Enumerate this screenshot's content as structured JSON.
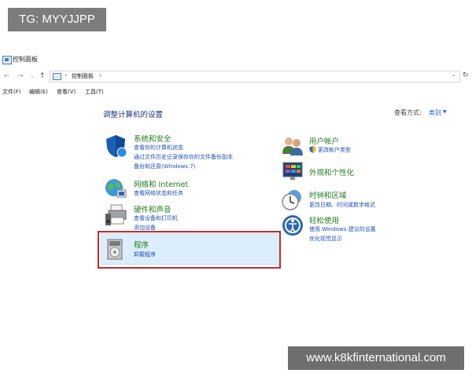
{
  "watermark_top": "TG: MYYJJPP",
  "window": {
    "title": "控制面板"
  },
  "address": {
    "crumb": "控制面板"
  },
  "menu": [
    "文件(F)",
    "编辑(E)",
    "查看(V)",
    "工具(T)"
  ],
  "page": {
    "title": "调整计算机的设置",
    "view_by_label": "查看方式:",
    "view_by_value": "类别"
  },
  "categories_left": [
    {
      "title": "系统和安全",
      "links": [
        "查看你的计算机状态",
        "通过文件历史记录保存你的文件备份副本",
        "备份和还原(Windows 7)"
      ]
    },
    {
      "title": "网络和 Internet",
      "links": [
        "查看网络状态和任务"
      ]
    },
    {
      "title": "硬件和声音",
      "links": [
        "查看设备和打印机",
        "添加设备"
      ]
    },
    {
      "title": "程序",
      "links": [
        "卸载程序"
      ]
    }
  ],
  "categories_right": [
    {
      "title": "用户帐户",
      "links": [
        "更改帐户类型"
      ]
    },
    {
      "title": "外观和个性化",
      "links": []
    },
    {
      "title": "时钟和区域",
      "links": [
        "更改日期、时间或数字格式"
      ]
    },
    {
      "title": "轻松使用",
      "links": [
        "使用 Windows 建议的设置",
        "优化视觉显示"
      ]
    }
  ],
  "watermark_bottom": "www.k8kfinternational.com"
}
